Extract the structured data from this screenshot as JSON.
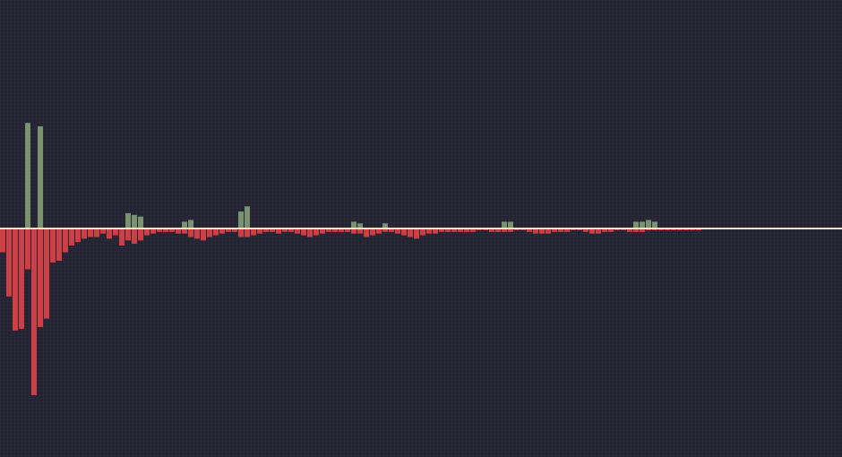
{
  "colors": {
    "background": "#232332",
    "grid": "#2d2d3d",
    "up": "#7a9270",
    "down": "#cc3f44",
    "baseline": "#efe4bd"
  },
  "chart_data": {
    "type": "bar",
    "title": "",
    "xlabel": "",
    "ylabel": "",
    "grid": true,
    "legend": "none",
    "ylim": [
      -10,
      13
    ],
    "bar_count": 112,
    "series": [
      {
        "key": "positive",
        "values": [
          0,
          0,
          0,
          0,
          6.2,
          0,
          6.0,
          0,
          0,
          0,
          0,
          0,
          0,
          0,
          0,
          0,
          0,
          0,
          0,
          0,
          0.9,
          0.8,
          0.7,
          0,
          0,
          0,
          0,
          0,
          0,
          0.4,
          0.5,
          0,
          0,
          0,
          0,
          0,
          0,
          0,
          1.0,
          1.3,
          0,
          0,
          0,
          0,
          0,
          0,
          0,
          0,
          0,
          0,
          0,
          0,
          0,
          0,
          0,
          0,
          0.4,
          0.3,
          0,
          0,
          0,
          0.3,
          0,
          0,
          0,
          0,
          0,
          0,
          0,
          0,
          0,
          0,
          0,
          0,
          0,
          0,
          0,
          0,
          0,
          0,
          0.4,
          0.4,
          0,
          0,
          0,
          0,
          0,
          0,
          0,
          0,
          0,
          0,
          0,
          0,
          0,
          0,
          0,
          0,
          0,
          0,
          0,
          0.4,
          0.4,
          0.5,
          0.4,
          0,
          0,
          0,
          0,
          0,
          0,
          0
        ]
      },
      {
        "key": "negative",
        "values": [
          -1.4,
          -4.0,
          -6.0,
          -5.9,
          -2.4,
          -9.8,
          -5.8,
          -5.3,
          -2.0,
          -1.9,
          -1.4,
          -1.0,
          -0.8,
          -0.6,
          -0.5,
          -0.5,
          -0.3,
          -0.6,
          -0.4,
          -1.0,
          -0.7,
          -0.9,
          -0.7,
          -0.4,
          -0.3,
          -0.2,
          -0.2,
          -0.2,
          -0.3,
          -0.3,
          -0.5,
          -0.6,
          -0.7,
          -0.5,
          -0.4,
          -0.3,
          -0.2,
          -0.2,
          -0.5,
          -0.5,
          -0.4,
          -0.3,
          -0.2,
          -0.2,
          -0.3,
          -0.2,
          -0.2,
          -0.3,
          -0.4,
          -0.5,
          -0.4,
          -0.3,
          -0.2,
          -0.2,
          -0.2,
          -0.2,
          -0.3,
          -0.3,
          -0.5,
          -0.4,
          -0.3,
          -0.2,
          -0.2,
          -0.3,
          -0.4,
          -0.5,
          -0.6,
          -0.4,
          -0.3,
          -0.3,
          -0.2,
          -0.2,
          -0.2,
          -0.2,
          -0.2,
          -0.2,
          -0.1,
          -0.1,
          -0.2,
          -0.2,
          -0.2,
          -0.2,
          -0.1,
          -0.1,
          -0.2,
          -0.3,
          -0.3,
          -0.3,
          -0.2,
          -0.2,
          -0.2,
          -0.1,
          -0.1,
          -0.2,
          -0.3,
          -0.3,
          -0.2,
          -0.2,
          -0.1,
          -0.1,
          -0.2,
          -0.2,
          -0.2,
          -0.1,
          -0.1,
          -0.1,
          -0.1,
          -0.1,
          -0.1,
          -0.1,
          -0.1,
          -0.1
        ]
      }
    ]
  }
}
